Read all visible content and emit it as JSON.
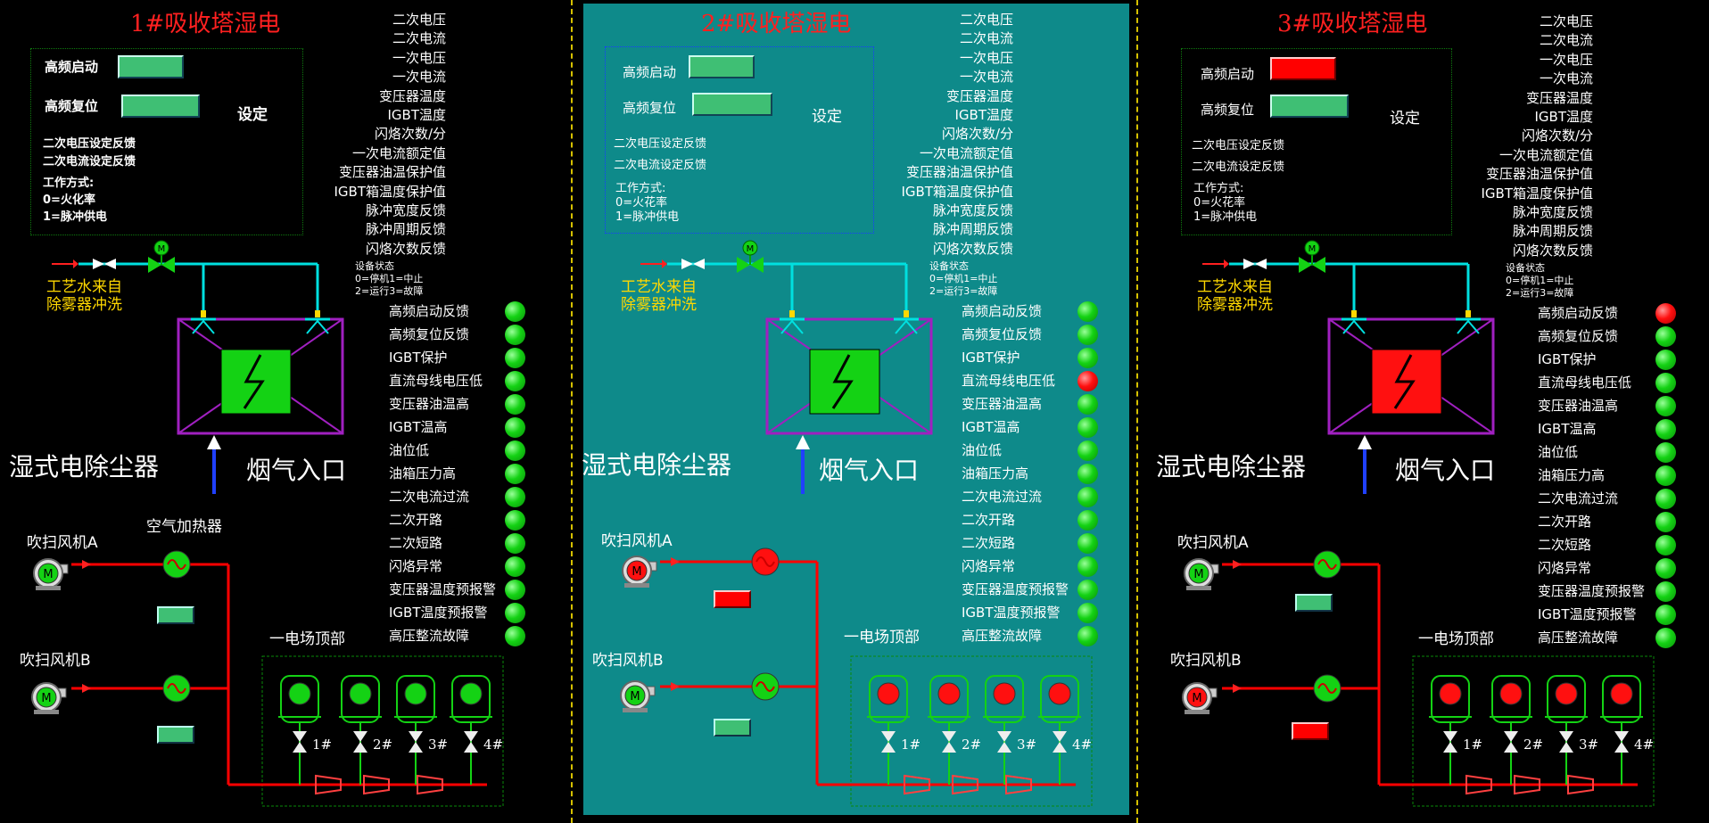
{
  "colors": {
    "run": "#14d214",
    "fault": "#ff1010",
    "pipe_water": "#00e0e0",
    "pipe_air": "#ff0000",
    "title": "#ff2020",
    "label_water": "#ffd800",
    "middle_bg": "#0e8a8a"
  },
  "param_labels": [
    "二次电压",
    "二次电流",
    "一次电压",
    "一次电流",
    "变压器温度",
    "IGBT温度",
    "闪烙次数/分",
    "一次电流额定值",
    "变压器油温保护值",
    "IGBT箱温度保护值",
    "脉冲宽度反馈",
    "脉冲周期反馈",
    "闪烙次数反馈"
  ],
  "status_labels": [
    "高频启动反馈",
    "高频复位反馈",
    "IGBT保护",
    "直流母线电压低",
    "变压器油温高",
    "IGBT温高",
    "油位低",
    "油箱压力高",
    "二次电流过流",
    "二次开路",
    "二次短路",
    "闪烙异常",
    "变压器温度预报警",
    "IGBT温度预报警",
    "高压整流故障"
  ],
  "device_state": {
    "title": "设备状态",
    "line1": "0=停机1=中止",
    "line2": "2=运行3=故障"
  },
  "panels": [
    {
      "title": "1#吸收塔湿电",
      "start_label": "高频启动",
      "start_state": "green",
      "reset_label": "高频复位",
      "reset_state": "green",
      "set_label": "设定",
      "feedback_v": "二次电压设定反馈",
      "feedback_i": "二次电流设定反馈",
      "mode_title": "工作方式:",
      "mode_0": "0=火化率",
      "mode_1": "1=脉冲供电",
      "water_line1": "工艺水来自",
      "water_line2": "除雾器冲洗",
      "valve_motor": "M",
      "precipitator": "湿式电除尘器",
      "flue_inlet": "烟气入口",
      "fan_a": "吹扫风机A",
      "fan_b": "吹扫风机B",
      "heater": "空气加热器",
      "fan_a_state": "green",
      "fan_b_state": "green",
      "heater_a_state": "green",
      "heater_b_state": "green",
      "box_state": "green",
      "top_label": "一电场顶部",
      "insulators": [
        "1#",
        "2#",
        "3#",
        "4#"
      ],
      "insulator_state": "green",
      "leds": [
        "g",
        "g",
        "g",
        "g",
        "g",
        "g",
        "g",
        "g",
        "g",
        "g",
        "g",
        "g",
        "g",
        "g",
        "g"
      ]
    },
    {
      "title": "2#吸收塔湿电",
      "start_label": "高频启动",
      "start_state": "green",
      "reset_label": "高频复位",
      "reset_state": "green",
      "set_label": "设定",
      "feedback_v": "二次电压设定反馈",
      "feedback_i": "二次电流设定反馈",
      "mode_title": "工作方式:",
      "mode_0": "0=火花率",
      "mode_1": "1=脉冲供电",
      "water_line1": "工艺水来自",
      "water_line2": "除雾器冲洗",
      "valve_motor": "M",
      "precipitator": "湿式电除尘器",
      "flue_inlet": "烟气入口",
      "fan_a": "吹扫风机A",
      "fan_b": "吹扫风机B",
      "heater": "",
      "fan_a_state": "red",
      "fan_b_state": "green",
      "heater_a_state": "red",
      "heater_b_state": "green",
      "box_state": "green",
      "top_label": "一电场顶部",
      "insulators": [
        "1#",
        "2#",
        "3#",
        "4#"
      ],
      "insulator_state": "red",
      "leds": [
        "g",
        "g",
        "g",
        "r",
        "g",
        "g",
        "g",
        "g",
        "g",
        "g",
        "g",
        "g",
        "g",
        "g",
        "g"
      ]
    },
    {
      "title": "3#吸收塔湿电",
      "start_label": "高频启动",
      "start_state": "red",
      "reset_label": "高频复位",
      "reset_state": "green",
      "set_label": "设定",
      "feedback_v": "二次电压设定反馈",
      "feedback_i": "二次电流设定反馈",
      "mode_title": "工作方式:",
      "mode_0": "0=火花率",
      "mode_1": "1=脉冲供电",
      "water_line1": "工艺水来自",
      "water_line2": "除雾器冲洗",
      "valve_motor": "M",
      "precipitator": "湿式电除尘器",
      "flue_inlet": "烟气入口",
      "fan_a": "吹扫风机A",
      "fan_b": "吹扫风机B",
      "heater": "",
      "fan_a_state": "green",
      "fan_b_state": "red",
      "heater_a_state": "green",
      "heater_b_state": "green",
      "box_state": "red",
      "top_label": "一电场顶部",
      "insulators": [
        "1#",
        "2#",
        "3#",
        "4#"
      ],
      "insulator_state": "red",
      "leds": [
        "r",
        "g",
        "g",
        "g",
        "g",
        "g",
        "g",
        "g",
        "g",
        "g",
        "g",
        "g",
        "g",
        "g",
        "g"
      ]
    }
  ]
}
